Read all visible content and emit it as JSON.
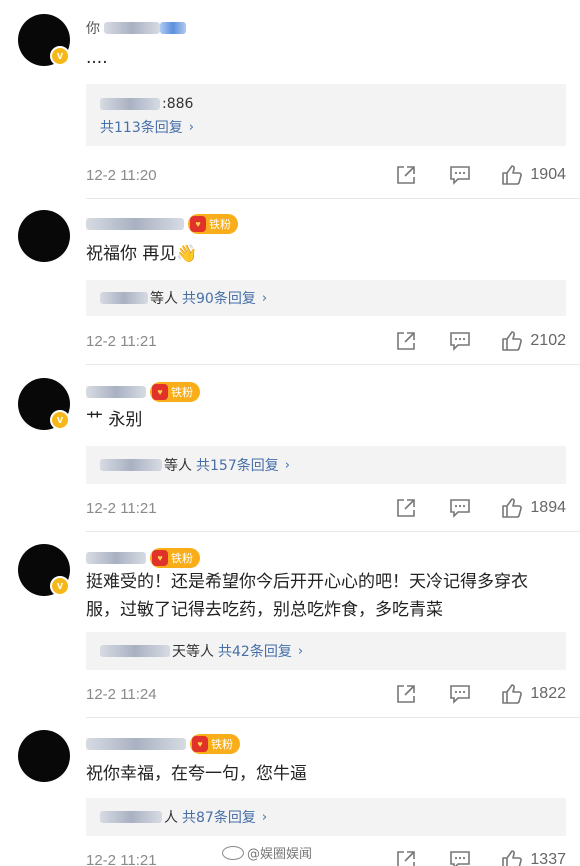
{
  "comments": [
    {
      "username": "你",
      "has_fan_badge": false,
      "text": "....",
      "reply_prefix": "",
      "reply_preview_text": "886",
      "reply_more": "共113条回复",
      "time": "12-2 11:20",
      "likes": "1904"
    },
    {
      "username": "",
      "has_fan_badge": true,
      "text": "祝福你 再见👋",
      "reply_prefix": "等人",
      "reply_more": "共90条回复",
      "time": "12-2 11:21",
      "likes": "2102"
    },
    {
      "username": "",
      "has_fan_badge": true,
      "text": "艹 永别",
      "reply_prefix": "等人",
      "reply_more": "共157条回复",
      "time": "12-2 11:21",
      "likes": "1894"
    },
    {
      "username": "",
      "has_fan_badge": true,
      "text": "挺难受的！还是希望你今后开开心心的吧！天冷记得多穿衣服，过敏了记得去吃药，别总吃炸食，多吃青菜",
      "reply_prefix": "天等人",
      "reply_more": "共42条回复",
      "time": "12-2 11:24",
      "likes": "1822"
    },
    {
      "username": "",
      "has_fan_badge": true,
      "text": "祝你幸福，在夸一句，您牛逼",
      "reply_prefix": "人",
      "reply_more": "共87条回复",
      "time": "12-2 11:21",
      "likes": "1337"
    }
  ],
  "fan_badge_label": "铁粉",
  "verified_mark": "v",
  "reply_chevron": "›",
  "watermark": "@娱圈娱闻",
  "icons": [
    "share-icon",
    "comment-icon",
    "like-icon",
    "verified-icon",
    "fan-badge-icon"
  ]
}
